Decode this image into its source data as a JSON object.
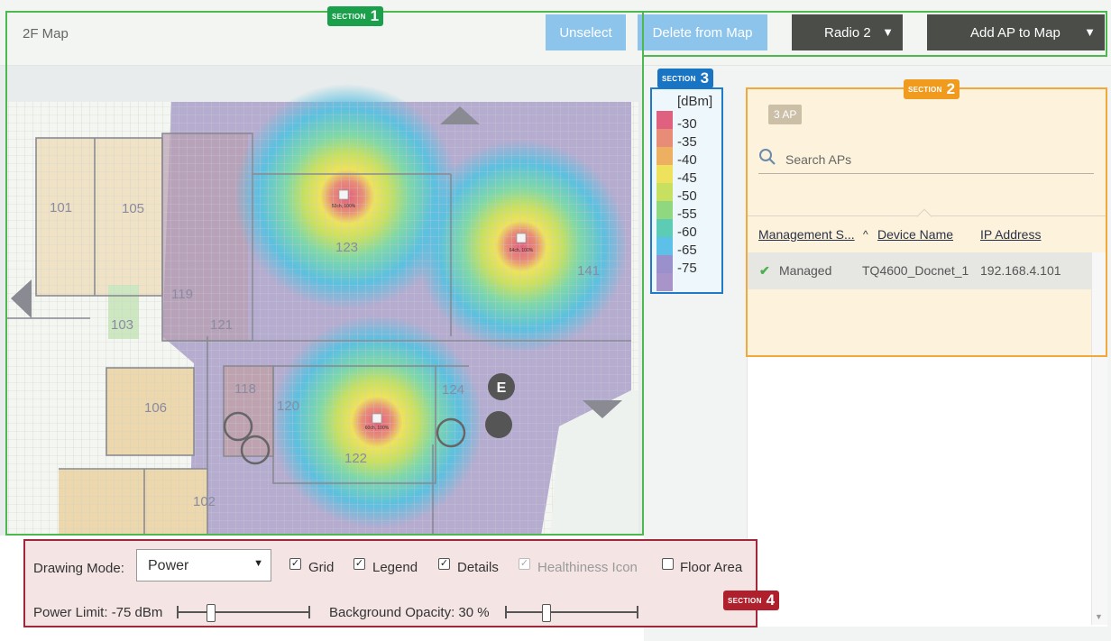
{
  "header": {
    "map_title": "2F Map",
    "unselect_label": "Unselect",
    "delete_label": "Delete from Map",
    "radio_label": "Radio 2",
    "add_ap_label": "Add AP to Map"
  },
  "map": {
    "rooms": [
      "101",
      "105",
      "103",
      "119",
      "121",
      "123",
      "141",
      "106",
      "118",
      "120",
      "124",
      "122",
      "102"
    ],
    "ap_labels": [
      "52ch, 100%",
      "64ch, 100%",
      "60ch, 100%"
    ],
    "elevator_label": "E"
  },
  "legend": {
    "unit": "[dBm]",
    "items": [
      {
        "label": "-30",
        "color": "#e06080"
      },
      {
        "label": "-35",
        "color": "#e88c78"
      },
      {
        "label": "-40",
        "color": "#ecb060"
      },
      {
        "label": "-45",
        "color": "#eee25c"
      },
      {
        "label": "-50",
        "color": "#c8e060"
      },
      {
        "label": "-55",
        "color": "#90d880"
      },
      {
        "label": "-60",
        "color": "#5cccb4"
      },
      {
        "label": "-65",
        "color": "#5cc0e8"
      },
      {
        "label": "-75",
        "color": "#9a90cc"
      },
      {
        "label": "",
        "color": "#a894c8"
      }
    ]
  },
  "ap_panel": {
    "count_badge": "3 AP",
    "search_placeholder": "Search APs",
    "columns": [
      "Management S...",
      "Device Name",
      "IP Address"
    ],
    "rows": [
      {
        "status": "Managed",
        "device": "TQ4600_Docnet_1",
        "ip": "192.168.4.101"
      }
    ]
  },
  "controls": {
    "drawing_mode_label": "Drawing Mode:",
    "drawing_mode_value": "Power",
    "grid_label": "Grid",
    "legend_label": "Legend",
    "details_label": "Details",
    "healthiness_label": "Healthiness Icon",
    "floor_area_label": "Floor Area",
    "power_limit_label": "Power Limit: -75 dBm",
    "power_limit_level": 0.24,
    "bg_opacity_label": "Background Opacity: 30 %",
    "bg_opacity_level": 0.3
  },
  "sections": [
    {
      "word": "SECTION",
      "number": "1",
      "color": "#1aa04a"
    },
    {
      "word": "SECTION",
      "number": "2",
      "color": "#f09a1e"
    },
    {
      "word": "SECTION",
      "number": "3",
      "color": "#1a74c4"
    },
    {
      "word": "SECTION",
      "number": "4",
      "color": "#b0202c"
    }
  ],
  "colors": {
    "section1": "#4db84d",
    "section2": "#f2a93b",
    "section3": "#1f7ac8",
    "section4": "#a0283a"
  }
}
